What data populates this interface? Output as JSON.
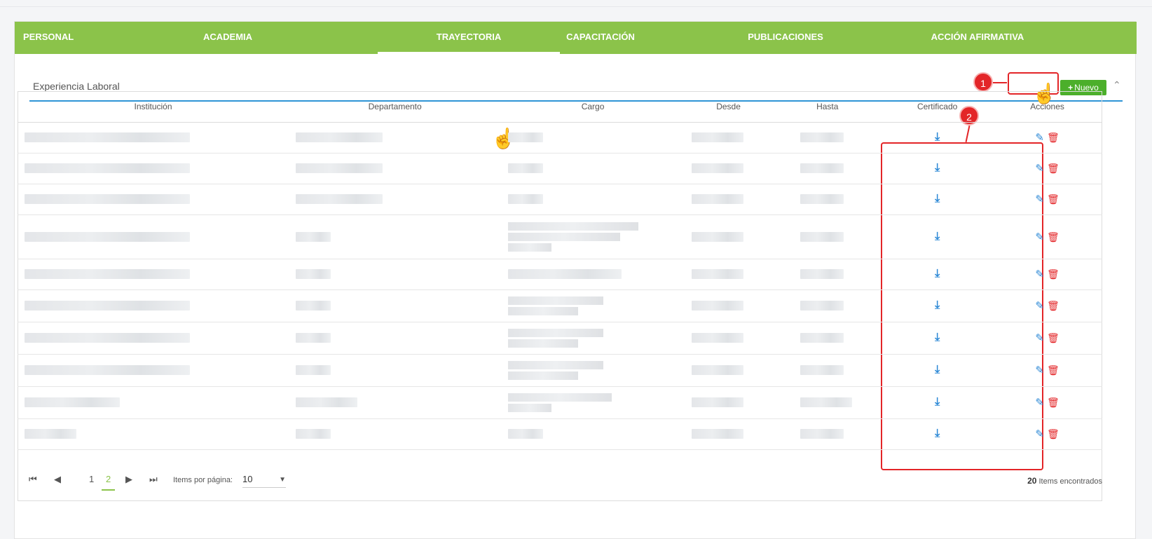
{
  "tabs": [
    {
      "label": "PERSONAL"
    },
    {
      "label": "ACADEMIA"
    },
    {
      "label": "TRAYECTORIA"
    },
    {
      "label": "CAPACITACIÓN"
    },
    {
      "label": "PUBLICACIONES"
    },
    {
      "label": "ACCIÓN AFIRMATIVA"
    }
  ],
  "section": {
    "title": "Experiencia Laboral",
    "new_button": "Nuevo",
    "collapse_icon": "chevron-up-icon"
  },
  "table": {
    "columns": [
      "Institución",
      "Departamento",
      "Cargo",
      "Desde",
      "Hasta",
      "Certificado",
      "Acciones"
    ]
  },
  "annotations": {
    "badge1": "1",
    "badge2": "2"
  },
  "pager": {
    "pages": [
      "1",
      "2"
    ],
    "current_page": "2",
    "items_label": "Items por página:",
    "page_size": "10",
    "total": "20",
    "total_label": "Items encontrados"
  },
  "colors": {
    "tab_bar": "#8bc34a",
    "accent_blue": "#2f8ad6",
    "new_button": "#4caf2b",
    "annotation_red": "#e32528"
  }
}
